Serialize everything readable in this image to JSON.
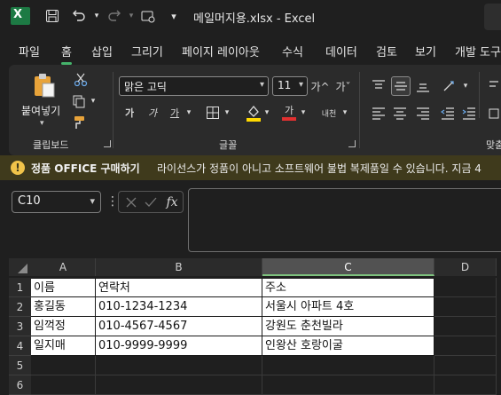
{
  "titlebar": {
    "app_logo": "X",
    "icons": [
      "save-icon",
      "undo-icon",
      "redo-icon",
      "touch-mode-icon",
      "customize-icon"
    ],
    "title": "메일머지용.xlsx  -  Excel"
  },
  "tabs": [
    "파일",
    "홈",
    "삽입",
    "그리기",
    "페이지 레이아웃",
    "수식",
    "데이터",
    "검토",
    "보기",
    "개발 도구"
  ],
  "active_tab": "홈",
  "ribbon": {
    "clipboard": {
      "paste_label": "붙여넣기",
      "group_label": "클립보드"
    },
    "font": {
      "font_name": "맑은 고딕",
      "font_size": "11",
      "grow_label": "가^",
      "shrink_label": "가ˇ",
      "bold_label": "가",
      "italic_label": "가",
      "underline_label": "가",
      "font_color_label": "가",
      "phonetic_label": "내천",
      "group_label": "글꼴",
      "font_color": "#e03030",
      "fill_color": "#ffd800"
    },
    "alignment": {
      "group_label": "맞춤"
    }
  },
  "notice": {
    "icon": "!",
    "title": "정품 OFFICE 구매하기",
    "text": "라이선스가 정품이 아니고 소프트웨어 불법 복제품일 수 있습니다. 지금 4"
  },
  "formula_bar": {
    "name_box": "C10",
    "fx_label": "fx",
    "formula": ""
  },
  "sheet": {
    "columns": [
      "A",
      "B",
      "C",
      "D"
    ],
    "selected_column": "C",
    "rows": [
      "1",
      "2",
      "3",
      "4",
      "5",
      "6"
    ],
    "cells": [
      [
        "이름",
        "연락처",
        "주소"
      ],
      [
        "홍길동",
        "010-1234-1234",
        "서울시 아파트 4호"
      ],
      [
        "임꺽정",
        "010-4567-4567",
        "강원도 춘천빌라"
      ],
      [
        "일지매",
        "010-9999-9999",
        "인왕산 호랑이굴"
      ]
    ]
  }
}
